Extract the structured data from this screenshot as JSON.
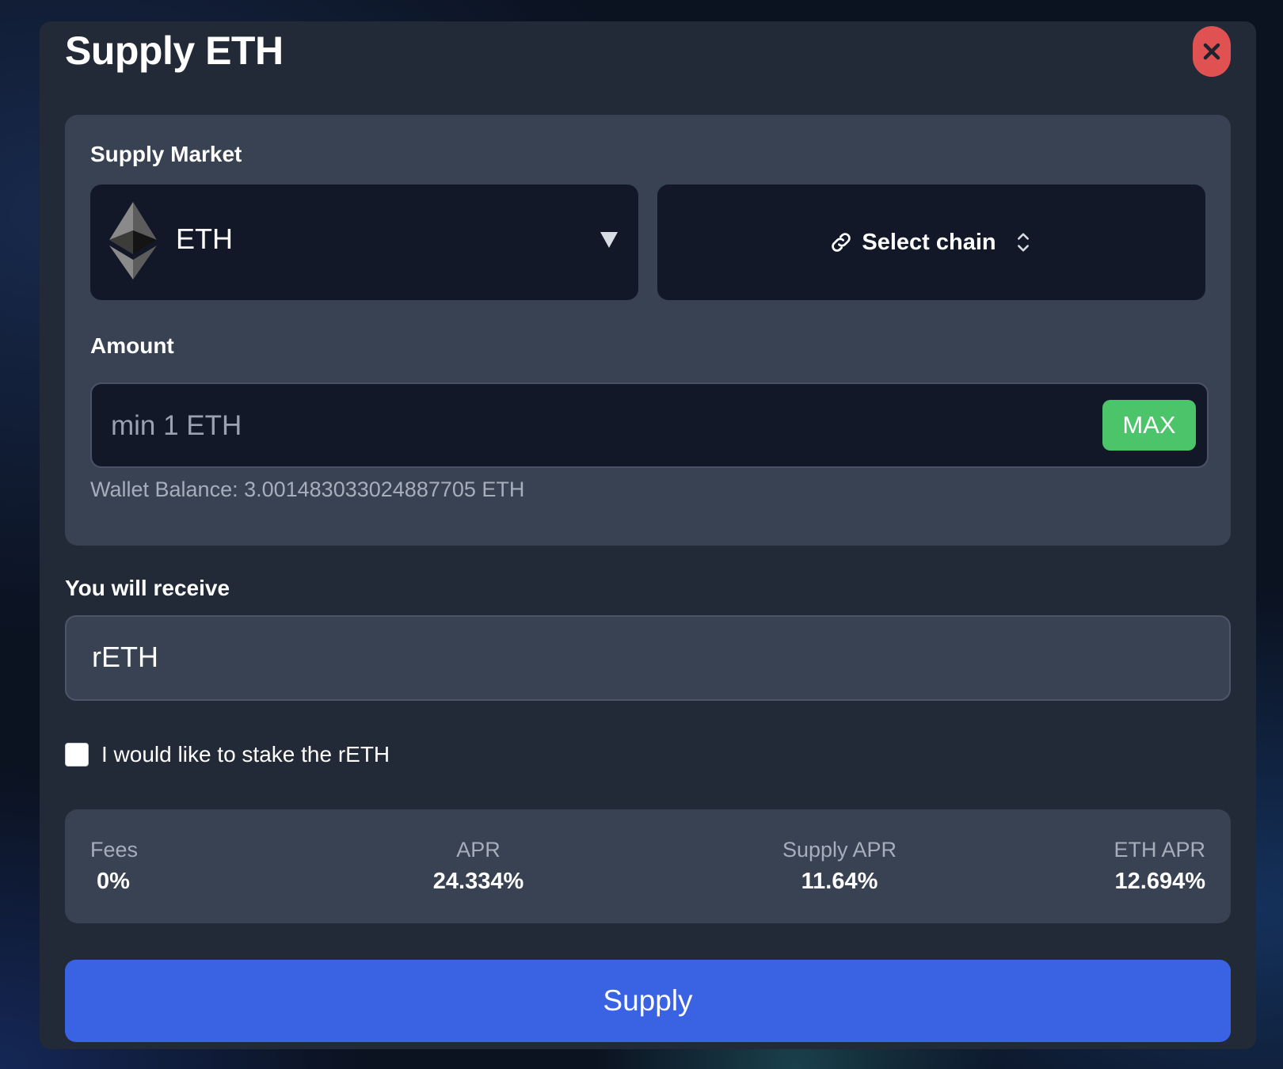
{
  "modal": {
    "title": "Supply ETH",
    "close_icon": "close-icon"
  },
  "supply_market": {
    "label": "Supply Market",
    "asset": {
      "symbol": "ETH",
      "icon": "ethereum-logo-icon",
      "caret_icon": "caret-down-icon"
    },
    "chain": {
      "label": "Select chain",
      "link_icon": "link-icon",
      "sort_icon": "chevron-up-down-icon"
    }
  },
  "amount": {
    "label": "Amount",
    "value": "",
    "placeholder": "min 1 ETH",
    "max_label": "MAX",
    "wallet_balance": "Wallet Balance: 3.001483033024887705 ETH"
  },
  "receive": {
    "label": "You will receive",
    "value": "rETH"
  },
  "stake": {
    "checked": false,
    "label": "I would like to stake the rETH"
  },
  "stats": {
    "fees": {
      "label": "Fees",
      "value": "0%"
    },
    "apr": {
      "label": "APR",
      "value": "24.334%"
    },
    "supply_apr": {
      "label": "Supply APR",
      "value": "11.64%"
    },
    "eth_apr": {
      "label": "ETH APR",
      "value": "12.694%"
    }
  },
  "actions": {
    "supply_label": "Supply"
  },
  "colors": {
    "modal_bg": "#222937",
    "panel_bg": "#394252",
    "input_bg": "#121828",
    "close_red": "#e05252",
    "max_green": "#4cc46a",
    "primary_blue": "#3a63e3",
    "muted_text": "#a7aebb"
  }
}
